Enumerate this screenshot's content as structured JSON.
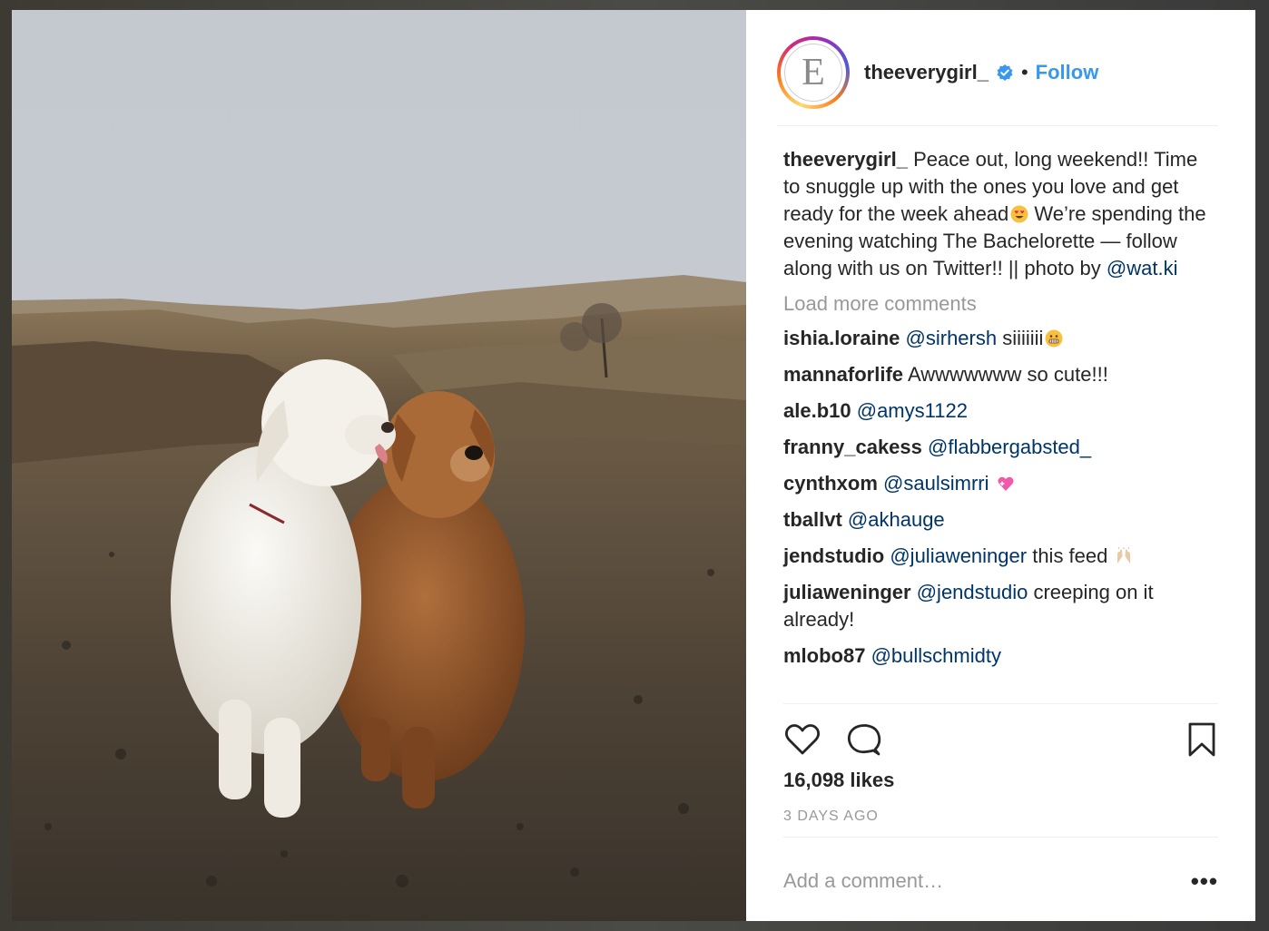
{
  "header": {
    "avatar_letter": "E",
    "username": "theeverygirl_",
    "separator": "•",
    "follow_label": "Follow"
  },
  "caption": {
    "username": "theeverygirl_",
    "text_part1": "Peace out, long weekend!! Time to snuggle up with the ones you love and get ready for the week ahead",
    "text_part2": "  We’re spending the evening watching The Bachelorette — follow along with us on Twitter!! || photo by ",
    "mention": "@wat.ki"
  },
  "load_more_label": "Load more comments",
  "comments": [
    {
      "user": "ishia.loraine",
      "mention": "@sirhersh",
      "text": " siiiiiii",
      "emoji": "grimacing-emoji"
    },
    {
      "user": "mannaforlife",
      "mention": "",
      "text": "Awwwwwww so cute!!!",
      "emoji": ""
    },
    {
      "user": "ale.b10",
      "mention": "@amys1122",
      "text": "",
      "emoji": ""
    },
    {
      "user": "franny_cakess",
      "mention": "@flabbergabsted_",
      "text": "",
      "emoji": ""
    },
    {
      "user": "cynthxom",
      "mention": "@saulsimrri",
      "text": " ",
      "emoji": "sparkling-heart-emoji"
    },
    {
      "user": "tballvt",
      "mention": "@akhauge",
      "text": "",
      "emoji": ""
    },
    {
      "user": "jendstudio",
      "mention": "@juliaweninger",
      "text": " this feed ",
      "emoji": "raised-hands-emoji"
    },
    {
      "user": "juliaweninger",
      "mention": "@jendstudio",
      "text": " creeping on it already!",
      "emoji": ""
    },
    {
      "user": "mlobo87",
      "mention": "@bullschmidty",
      "text": "",
      "emoji": ""
    }
  ],
  "actions": {
    "like_icon": "heart-icon",
    "comment_icon": "comment-icon",
    "save_icon": "bookmark-icon"
  },
  "likes": "16,098 likes",
  "timestamp": "3 DAYS AGO",
  "add_comment": {
    "placeholder": "Add a comment…",
    "more_label": "•••"
  },
  "colors": {
    "link": "#3897f0",
    "mention": "#003569",
    "muted": "#999999",
    "text": "#262626"
  }
}
